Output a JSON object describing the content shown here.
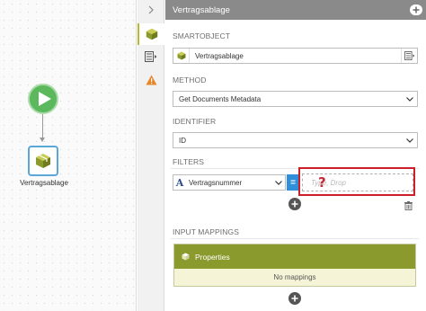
{
  "canvas": {
    "node_label": "Vertragsablage"
  },
  "panel": {
    "title": "Vertragsablage"
  },
  "smartobject": {
    "label": "SMARTOBJECT",
    "value": "Vertragsablage"
  },
  "method": {
    "label": "METHOD",
    "value": "Get Documents Metadata"
  },
  "identifier": {
    "label": "IDENTIFIER",
    "value": "ID"
  },
  "filters": {
    "label": "FILTERS",
    "field": "Vertragsnummer",
    "operator": "=",
    "value_placeholder": "Type, Drop",
    "help_marker": "?"
  },
  "input_mappings": {
    "label": "INPUT MAPPINGS",
    "group": "Properties",
    "empty_text": "No mappings"
  },
  "colors": {
    "accent_olive": "#8b9a2d",
    "start_green": "#5cb85c",
    "operator_blue": "#2f8fd8",
    "highlight_red": "#cc1f2a",
    "warning_orange": "#e8862a"
  }
}
